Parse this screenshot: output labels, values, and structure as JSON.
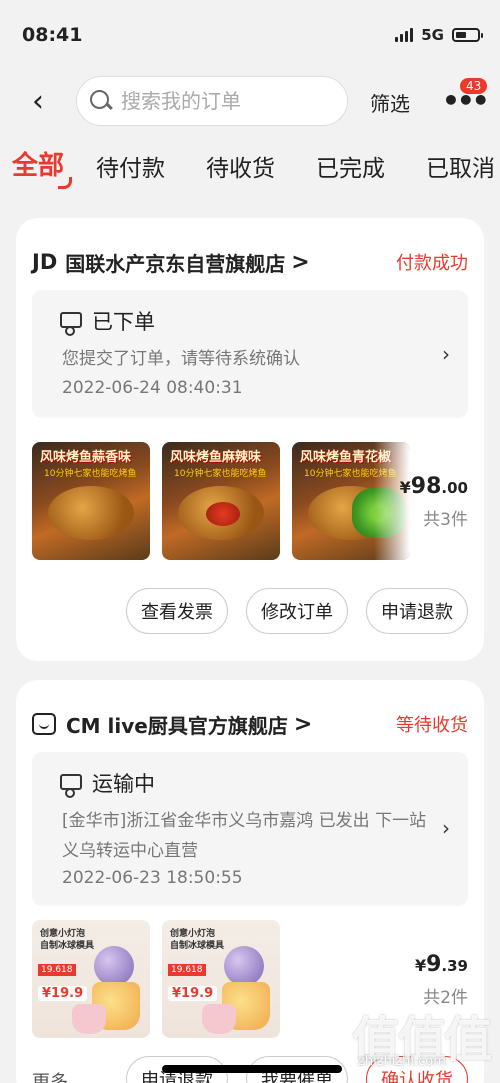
{
  "status_bar": {
    "time": "08:41",
    "network": "5G"
  },
  "nav": {
    "back_icon": "‹",
    "search_placeholder": "搜索我的订单",
    "filter_label": "筛选",
    "more_icon": "•••",
    "badge_count": "43"
  },
  "tabs": [
    {
      "label": "全部",
      "active": true
    },
    {
      "label": "待付款",
      "active": false
    },
    {
      "label": "待收货",
      "active": false
    },
    {
      "label": "已完成",
      "active": false
    },
    {
      "label": "已取消",
      "active": false
    }
  ],
  "orders": [
    {
      "shop_logo": "JD",
      "shop_name": "国联水产京东自营旗舰店",
      "shop_arrow": ">",
      "status": "付款成功",
      "progress_title": "已下单",
      "progress_desc": "您提交了订单，请等待系统确认",
      "progress_time": "2022-06-24 08:40:31",
      "products": [
        {
          "tag": "风味烤鱼蒜香味",
          "subtag": "10分钟七家也能吃烤鱼"
        },
        {
          "tag": "风味烤鱼麻辣味",
          "subtag": "10分钟七家也能吃烤鱼"
        },
        {
          "tag": "风味烤鱼青花椒",
          "subtag": "10分钟七家也能吃烤鱼"
        }
      ],
      "price_yen": "¥",
      "price_int": "98",
      "price_dec": ".00",
      "count": "共3件",
      "buttons": [
        "查看发票",
        "修改订单",
        "申请退款"
      ]
    },
    {
      "shop_name": "CM live厨具官方旗舰店",
      "shop_arrow": ">",
      "status": "等待收货",
      "progress_title": "运输中",
      "progress_desc": "[金华市]浙江省金华市义乌市嘉鸿 已发出 下一站 义乌转运中心直营",
      "progress_time": "2022-06-23 18:50:55",
      "products": [
        {
          "tag": "创意小灯泡\n自制冰球模具",
          "badge": "19.618",
          "price": "¥19.9"
        },
        {
          "tag": "创意小灯泡\n自制冰球模具",
          "badge": "19.618",
          "price": "¥19.9"
        }
      ],
      "price_yen": "¥",
      "price_int": "9",
      "price_dec": ".39",
      "count": "共2件",
      "more_label": "更多",
      "buttons": [
        "申请退款",
        "我要催单",
        "确认收货"
      ]
    }
  ],
  "watermark": {
    "text": "zhizhizhi.com",
    "glyph": "值"
  },
  "colors": {
    "accent": "#e93a2d",
    "background": "#f2f2f2"
  }
}
